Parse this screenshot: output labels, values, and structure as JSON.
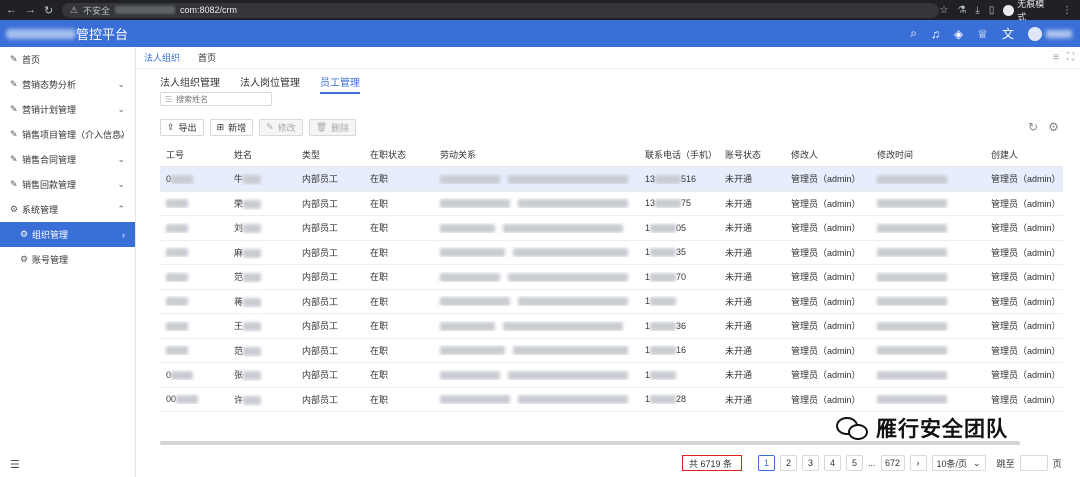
{
  "browser": {
    "insecure_label": "不安全",
    "host_suffix": "com:8082/crm",
    "incognito_label": "无痕模式"
  },
  "app": {
    "title": "管控平台"
  },
  "sidebar": {
    "items": [
      {
        "label": "首页"
      },
      {
        "label": "营销态势分析"
      },
      {
        "label": "营销计划管理"
      },
      {
        "label": "销售项目管理（介入信息）"
      },
      {
        "label": "销售合同管理"
      },
      {
        "label": "销售回款管理"
      },
      {
        "label": "系统管理"
      },
      {
        "label": "组织管理"
      },
      {
        "label": "账号管理"
      }
    ]
  },
  "tabs": {
    "t1": "法人组织",
    "t2": "首页"
  },
  "subtabs": {
    "s1": "法人组织管理",
    "s2": "法人岗位管理",
    "s3": "员工管理"
  },
  "search": {
    "placeholder": "搜索姓名"
  },
  "toolbar": {
    "export": "导出",
    "add": "新增",
    "edit": "修改",
    "delete": "删除"
  },
  "table": {
    "headers": [
      "工号",
      "姓名",
      "类型",
      "在职状态",
      "劳动关系",
      "联系电话（手机）",
      "账号状态",
      "修改人",
      "修改时间",
      "创建人"
    ],
    "rows": [
      {
        "id": "0",
        "name": "牛",
        "type": "内部员工",
        "status": "在职",
        "phone_pre": "13",
        "phone_suf": "516",
        "acct": "未开通",
        "modifier": "管理员（admin）",
        "creator": "管理员（admin）"
      },
      {
        "id": "",
        "name": "荣",
        "type": "内部员工",
        "status": "在职",
        "phone_pre": "13",
        "phone_suf": "75",
        "acct": "未开通",
        "modifier": "管理员（admin）",
        "creator": "管理员（admin）"
      },
      {
        "id": "",
        "name": "刘",
        "type": "内部员工",
        "status": "在职",
        "phone_pre": "1",
        "phone_suf": "05",
        "acct": "未开通",
        "modifier": "管理员（admin）",
        "creator": "管理员（admin）"
      },
      {
        "id": "",
        "name": "麻",
        "type": "内部员工",
        "status": "在职",
        "phone_pre": "1",
        "phone_suf": "35",
        "acct": "未开通",
        "modifier": "管理员（admin）",
        "creator": "管理员（admin）"
      },
      {
        "id": "",
        "name": "范",
        "type": "内部员工",
        "status": "在职",
        "phone_pre": "1",
        "phone_suf": "70",
        "acct": "未开通",
        "modifier": "管理员（admin）",
        "creator": "管理员（admin）"
      },
      {
        "id": "",
        "name": "蒋",
        "type": "内部员工",
        "status": "在职",
        "phone_pre": "1",
        "phone_suf": "",
        "acct": "未开通",
        "modifier": "管理员（admin）",
        "creator": "管理员（admin）"
      },
      {
        "id": "",
        "name": "王",
        "type": "内部员工",
        "status": "在职",
        "phone_pre": "1",
        "phone_suf": "36",
        "acct": "未开通",
        "modifier": "管理员（admin）",
        "creator": "管理员（admin）"
      },
      {
        "id": "",
        "name": "范",
        "type": "内部员工",
        "status": "在职",
        "phone_pre": "1",
        "phone_suf": "16",
        "acct": "未开通",
        "modifier": "管理员（admin）",
        "creator": "管理员（admin）"
      },
      {
        "id": "0",
        "name": "张",
        "type": "内部员工",
        "status": "在职",
        "phone_pre": "1",
        "phone_suf": "",
        "acct": "未开通",
        "modifier": "管理员（admin）",
        "creator": "管理员（admin）"
      },
      {
        "id": "00",
        "name": "许",
        "type": "内部员工",
        "status": "在职",
        "phone_pre": "1",
        "phone_suf": "28",
        "acct": "未开通",
        "modifier": "管理员（admin）",
        "creator": "管理员（admin）"
      }
    ]
  },
  "pagination": {
    "total": "共 6719 条",
    "pages": [
      "1",
      "2",
      "3",
      "4",
      "5"
    ],
    "ellipsis": "...",
    "last": "672",
    "next": "›",
    "page_size": "10条/页",
    "jump_label": "跳至",
    "page_unit": "页"
  },
  "watermark": {
    "text": "雁行安全团队"
  },
  "colors": {
    "primary": "#3a6fd8",
    "highlight": "#e02020"
  }
}
